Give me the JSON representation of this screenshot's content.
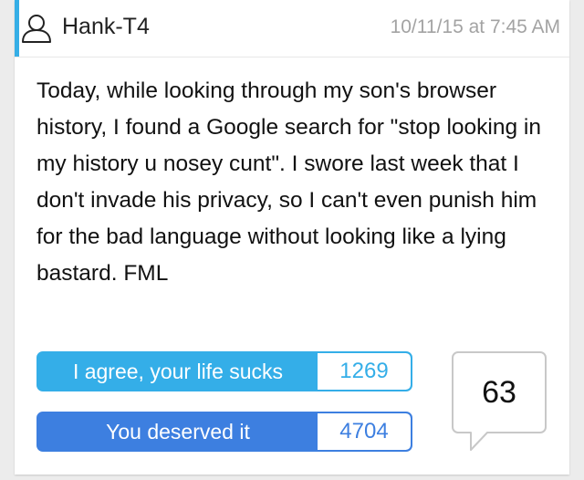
{
  "post": {
    "username": "Hank-T4",
    "timestamp": "10/11/15 at 7:45 AM",
    "story": "Today, while looking through my son's browser history, I found a Google search for \"stop looking in my history u nosey cunt\". I swore last week that I don't invade his privacy, so I can't even punish him for the bad language without looking like a lying bastard. FML"
  },
  "votes": {
    "agree": {
      "label": "I agree, your life sucks",
      "count": "1269"
    },
    "deserved": {
      "label": "You deserved it",
      "count": "4704"
    }
  },
  "comments": {
    "count": "63"
  },
  "icons": {
    "user": "user-outline-icon",
    "comment": "speech-bubble-icon"
  },
  "colors": {
    "accent": "#35aee6",
    "agree": "#34aee8",
    "deserved": "#3d7fe0",
    "timestamp": "#a3a3a3"
  }
}
